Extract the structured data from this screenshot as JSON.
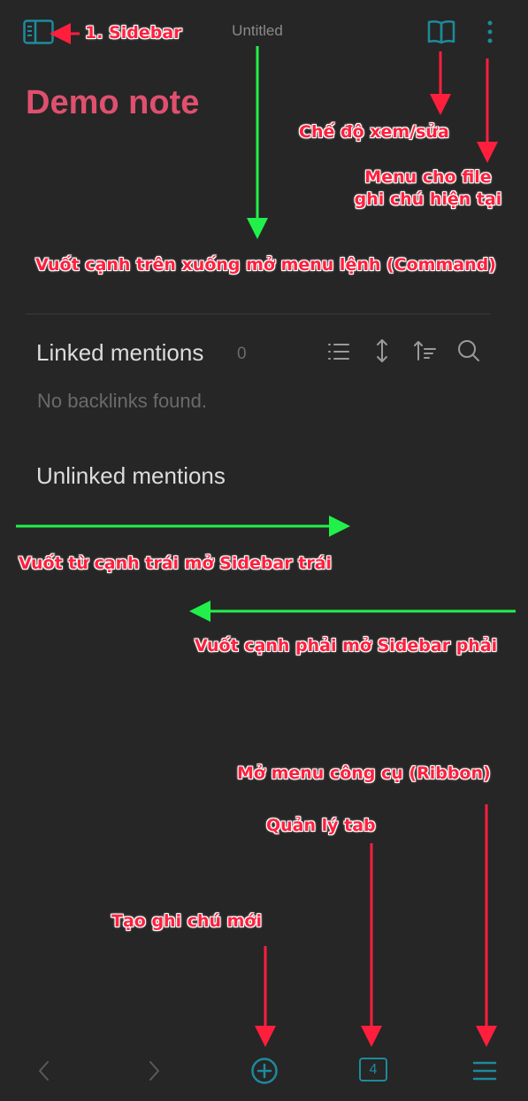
{
  "topbar": {
    "title": "Untitled",
    "icons": [
      "sidebar-toggle-icon",
      "book-open-icon",
      "more-vertical-icon"
    ]
  },
  "note": {
    "title": "Demo note"
  },
  "backlinks": {
    "linked_label": "Linked mentions",
    "linked_count": "0",
    "empty_text": "No backlinks found.",
    "unlinked_label": "Unlinked mentions",
    "tool_icons": [
      "list-icon",
      "expand-vertical-icon",
      "sort-icon",
      "search-icon"
    ]
  },
  "bottombar": {
    "tab_count": "4",
    "icons": [
      "back-arrow-icon",
      "forward-arrow-icon",
      "plus-circle-icon",
      "tab-count-icon",
      "menu-icon"
    ]
  },
  "annotations": {
    "sidebar": "1. Sidebar",
    "view_edit": "Chế độ xem/sửa",
    "file_menu_line1": "Menu cho file",
    "file_menu_line2": "ghi chú hiện tại",
    "command": "Vuốt cạnh trên xuống mở menu lệnh (Command)",
    "left_sidebar": "Vuốt từ cạnh trái mở Sidebar trái",
    "right_sidebar": "Vuốt cạnh phải mở Sidebar phải",
    "ribbon": "Mở menu công cụ (Ribbon)",
    "tabs": "Quản lý tab",
    "new_note": "Tạo ghi chú mới"
  },
  "colors": {
    "background": "#262626",
    "accent": "#1e8a9c",
    "note_title": "#e0506e",
    "annotation_red": "#ff1f3d",
    "arrow_green": "#22f04a"
  }
}
